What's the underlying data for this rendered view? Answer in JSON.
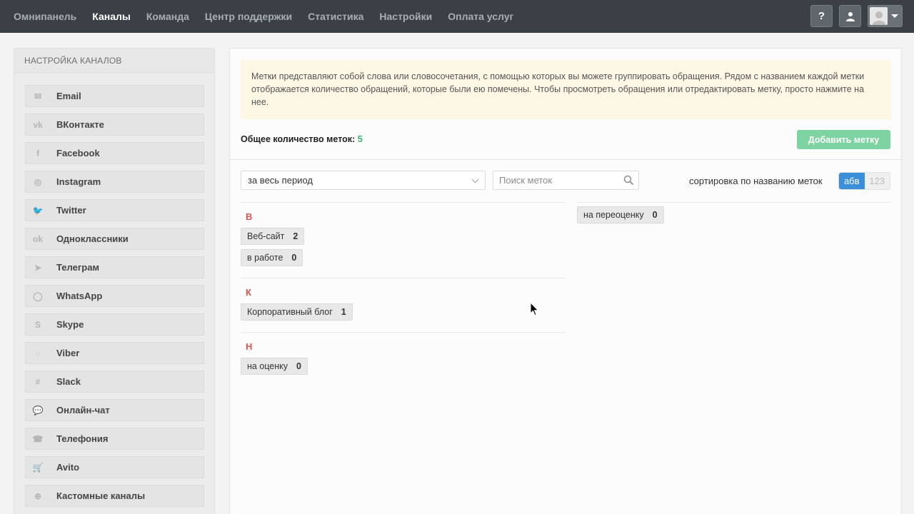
{
  "nav": {
    "items": [
      "Омнипанель",
      "Каналы",
      "Команда",
      "Центр поддержки",
      "Статистика",
      "Настройки",
      "Оплата услуг"
    ],
    "active_index": 1,
    "help_label": "?"
  },
  "sidebar": {
    "title": "НАСТРОЙКА КАНАЛОВ",
    "items": [
      {
        "label": "Email",
        "icon": "email-icon",
        "glyph": "✉"
      },
      {
        "label": "ВКонтакте",
        "icon": "vk-icon",
        "glyph": "vk"
      },
      {
        "label": "Facebook",
        "icon": "facebook-icon",
        "glyph": "f"
      },
      {
        "label": "Instagram",
        "icon": "instagram-icon",
        "glyph": "◎"
      },
      {
        "label": "Twitter",
        "icon": "twitter-icon",
        "glyph": "🐦"
      },
      {
        "label": "Одноклассники",
        "icon": "odnoklassniki-icon",
        "glyph": "ok"
      },
      {
        "label": "Телеграм",
        "icon": "telegram-icon",
        "glyph": "➤"
      },
      {
        "label": "WhatsApp",
        "icon": "whatsapp-icon",
        "glyph": "◯"
      },
      {
        "label": "Skype",
        "icon": "skype-icon",
        "glyph": "S"
      },
      {
        "label": "Viber",
        "icon": "viber-icon",
        "glyph": "◌"
      },
      {
        "label": "Slack",
        "icon": "slack-icon",
        "glyph": "#"
      },
      {
        "label": "Онлайн-чат",
        "icon": "chat-icon",
        "glyph": "💬"
      },
      {
        "label": "Телефония",
        "icon": "phone-icon",
        "glyph": "☎"
      },
      {
        "label": "Avito",
        "icon": "cart-icon",
        "glyph": "🛒"
      },
      {
        "label": "Кастомные каналы",
        "icon": "plus-circle-icon",
        "glyph": "⊕"
      }
    ]
  },
  "notice": {
    "text": "Метки представляют собой слова или словосочетания, с помощью которых вы можете группировать обращения. Рядом с названием каждой метки отображается количество обращений, которые были ею помечены. Чтобы просмотреть обращения или отредактировать метку, просто нажмите на нее."
  },
  "summary": {
    "label": "Общее количество меток:",
    "count": "5"
  },
  "add_button": "Добавить метку",
  "filters": {
    "period_value": "за весь период",
    "search_placeholder": "Поиск меток",
    "sort_label": "сортировка по названию меток",
    "sort_alpha": "абв",
    "sort_numeric": "123"
  },
  "groups": [
    {
      "letter": "В",
      "tags": [
        {
          "name": "Веб-сайт",
          "count": "2"
        },
        {
          "name": "в работе",
          "count": "0"
        }
      ]
    },
    {
      "letter": "К",
      "tags": [
        {
          "name": "Корпоративный блог",
          "count": "1"
        }
      ]
    },
    {
      "letter": "Н",
      "tags": [
        {
          "name": "на оценку",
          "count": "0"
        }
      ]
    }
  ],
  "right_tags": [
    {
      "name": "на переоценку",
      "count": "0"
    }
  ],
  "colors": {
    "topbar": "#3a4046",
    "accent_green": "#3cb371",
    "add_button": "#7dd3a1",
    "letter_red": "#d9534f",
    "sort_active": "#3b8fd9",
    "notice_bg": "#fcf8e5"
  }
}
